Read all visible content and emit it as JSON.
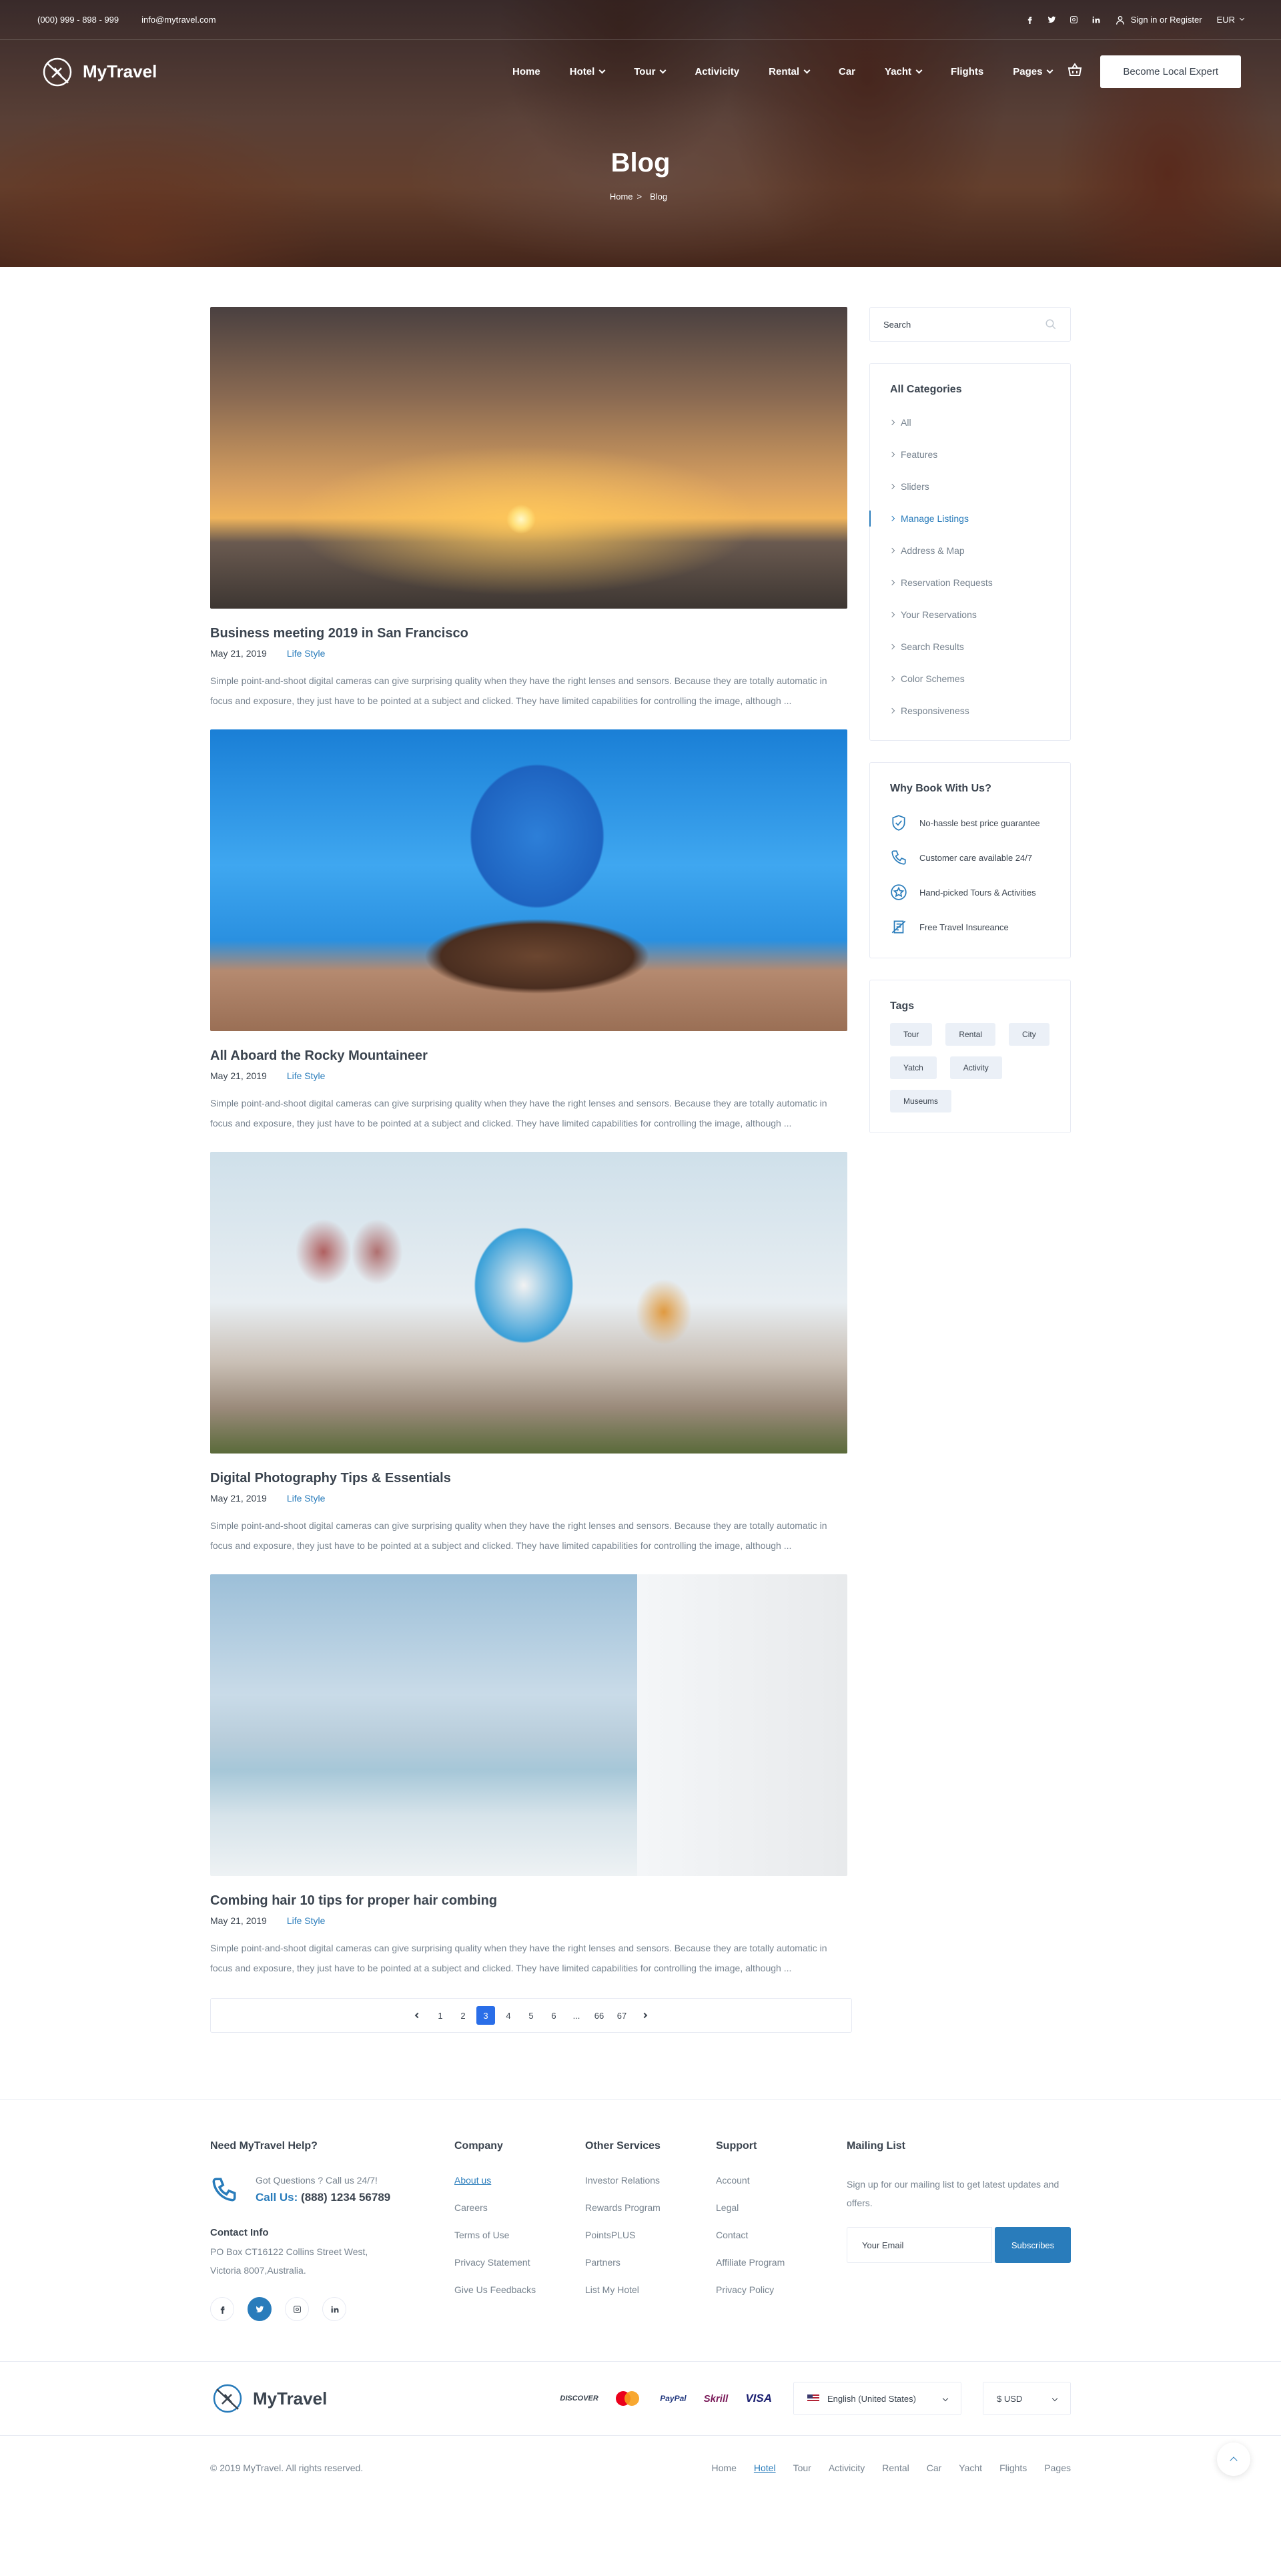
{
  "topbar": {
    "phone": "(000) 999 - 898 - 999",
    "email": "info@mytravel.com",
    "signin": "Sign in or Register",
    "currency": "EUR"
  },
  "brand": {
    "name": "MyTravel"
  },
  "nav": {
    "items": [
      {
        "label": "Home",
        "dropdown": false
      },
      {
        "label": "Hotel",
        "dropdown": true
      },
      {
        "label": "Tour",
        "dropdown": true
      },
      {
        "label": "Activicity",
        "dropdown": false
      },
      {
        "label": "Rental",
        "dropdown": true
      },
      {
        "label": "Car",
        "dropdown": false
      },
      {
        "label": "Yacht",
        "dropdown": true
      },
      {
        "label": "Flights",
        "dropdown": false
      },
      {
        "label": "Pages",
        "dropdown": true
      }
    ],
    "cta": "Become Local Expert"
  },
  "hero": {
    "title": "Blog",
    "crumb_home": "Home",
    "crumb_sep": ">",
    "crumb_current": "Blog"
  },
  "posts": [
    {
      "title": "Business meeting 2019 in San Francisco",
      "date": "May 21, 2019",
      "category": "Life Style",
      "excerpt": "Simple point-and-shoot digital cameras can give surprising quality when they have the right lenses and sensors. Because they are totally automatic in focus and exposure, they just have to be pointed at a subject and clicked. They have limited capabilities for controlling the image, although ..."
    },
    {
      "title": "All Aboard the Rocky Mountaineer",
      "date": "May 21, 2019",
      "category": "Life Style",
      "excerpt": "Simple point-and-shoot digital cameras can give surprising quality when they have the right lenses and sensors. Because they are totally automatic in focus and exposure, they just have to be pointed at a subject and clicked. They have limited capabilities for controlling the image, although ..."
    },
    {
      "title": "Digital Photography Tips & Essentials",
      "date": "May 21, 2019",
      "category": "Life Style",
      "excerpt": "Simple point-and-shoot digital cameras can give surprising quality when they have the right lenses and sensors. Because they are totally automatic in focus and exposure, they just have to be pointed at a subject and clicked. They have limited capabilities for controlling the image, although ..."
    },
    {
      "title": "Combing hair 10 tips for proper hair combing",
      "date": "May 21, 2019",
      "category": "Life Style",
      "excerpt": "Simple point-and-shoot digital cameras can give surprising quality when they have the right lenses and sensors. Because they are totally automatic in focus and exposure, they just have to be pointed at a subject and clicked. They have limited capabilities for controlling the image, although ..."
    }
  ],
  "pagination": {
    "pages": [
      "1",
      "2",
      "3",
      "4",
      "5",
      "6",
      "...",
      "66",
      "67"
    ],
    "active": "3"
  },
  "sidebar": {
    "search_placeholder": "Search",
    "categories_title": "All Categories",
    "categories": [
      "All",
      "Features",
      "Sliders",
      "Manage Listings",
      "Address & Map",
      "Reservation Requests",
      "Your Reservations",
      "Search Results",
      "Color Schemes",
      "Responsiveness"
    ],
    "active_category": "Manage Listings",
    "why_title": "Why Book With Us?",
    "why": [
      {
        "icon": "shield-icon",
        "text": "No-hassle best price guarantee"
      },
      {
        "icon": "phone-icon",
        "text": "Customer care available 24/7"
      },
      {
        "icon": "star-badge-icon",
        "text": "Hand-picked Tours & Activities"
      },
      {
        "icon": "insurance-icon",
        "text": "Free Travel Insureance"
      }
    ],
    "tags_title": "Tags",
    "tags": [
      "Tour",
      "Rental",
      "City",
      "Yatch",
      "Activity",
      "Museums"
    ]
  },
  "footer": {
    "help_title": "Need MyTravel Help?",
    "help_question": "Got Questions ? Call us 24/7!",
    "call_label": "Call Us:",
    "call_number": "(888) 1234 56789",
    "contact_title": "Contact Info",
    "address": "PO Box CT16122 Collins Street West, Victoria 8007,Australia.",
    "company_title": "Company",
    "company": [
      "About us",
      "Careers",
      "Terms of Use",
      "Privacy Statement",
      "Give Us Feedbacks"
    ],
    "services_title": "Other Services",
    "services": [
      "Investor Relations",
      "Rewards Program",
      "PointsPLUS",
      "Partners",
      "List My Hotel"
    ],
    "support_title": "Support",
    "support": [
      "Account",
      "Legal",
      "Contact",
      "Affiliate Program",
      "Privacy Policy"
    ],
    "mailing_title": "Mailing List",
    "mailing_text": "Sign up for our mailing list to get latest updates and offers.",
    "email_placeholder": "Your Email",
    "subscribe": "Subscribes",
    "payments": [
      "DISCOVER",
      "mastercard",
      "PayPal",
      "Skrill",
      "VISA"
    ],
    "language": "English (United States)",
    "currency": "$ USD",
    "copyright": "© 2019 MyTravel. All rights reserved.",
    "bottom_links": [
      "Home",
      "Hotel",
      "Tour",
      "Activicity",
      "Rental",
      "Car",
      "Yacht",
      "Flights",
      "Pages"
    ]
  },
  "colors": {
    "accent": "#297cbb",
    "text": "#3b444f",
    "muted": "#77838f",
    "border": "#e7eaf3"
  }
}
